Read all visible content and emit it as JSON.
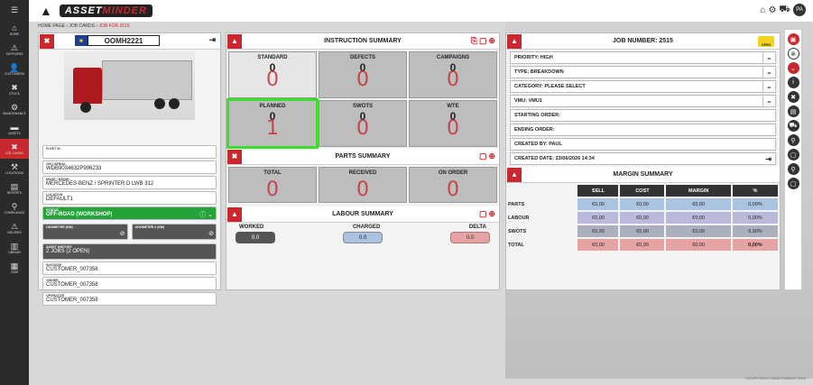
{
  "nav": [
    {
      "icon": "☰",
      "label": ""
    },
    {
      "icon": "⌂",
      "label": "Home"
    },
    {
      "icon": "⚠",
      "label": "Suppliers"
    },
    {
      "icon": "👤",
      "label": "Customers"
    },
    {
      "icon": "✖",
      "label": "Stock"
    },
    {
      "icon": "⚙",
      "label": "Maintenance"
    },
    {
      "icon": "▬",
      "label": "Assets"
    },
    {
      "icon": "✖",
      "label": "Job Cards"
    },
    {
      "icon": "⚒",
      "label": "Locations"
    },
    {
      "icon": "▤",
      "label": "Reports"
    },
    {
      "icon": "⚲",
      "label": "Compliance"
    },
    {
      "icon": "⚠",
      "label": "Drivers"
    },
    {
      "icon": "▥",
      "label": "Library"
    },
    {
      "icon": "▦",
      "label": "DSM"
    }
  ],
  "brand": {
    "prefix": "ASSET",
    "suffix": "MINDER"
  },
  "avatar": "PA",
  "breadcrumb": {
    "home": "HOME PAGE",
    "sep": " › ",
    "jobcards": "JOB CARDS",
    "current": "JOB FOR 2515"
  },
  "asset": {
    "reg": "OOMH2221",
    "fleet_id_label": "FLEET ID",
    "fleet_id": "",
    "vin_label": "VIN / SERIAL",
    "vin": "WDB9034632P996233",
    "make_label": "MAKE / MODEL",
    "make": "MERCEDES-BENZ / SPRINTER D LWB 312",
    "location_label": "LOCATION",
    "location": "DEFAULT1",
    "status_label": "STATUS",
    "status": "OFF-ROAD (WORKSHOP)",
    "odo_label": "ODOMETER (KM)",
    "odo2_label": "ODOMETER 2 (KM)",
    "history_label": "ASSET HISTORY",
    "history": "2 JOBS (2 OPEN)",
    "invoicee_label": "INVOICEE",
    "invoicee": "CUSTOMER_007358",
    "owner_label": "OWNER",
    "owner": "CUSTOMER_007358",
    "operator_label": "OPERATOR",
    "operator": "CUSTOMER_007358"
  },
  "instruction": {
    "title": "INSTRUCTION SUMMARY",
    "cells": [
      {
        "t": "STANDARD",
        "n": "0",
        "g": "0"
      },
      {
        "t": "DEFECTS",
        "n": "0",
        "g": "0"
      },
      {
        "t": "CAMPAIGNS",
        "n": "0",
        "g": "0"
      },
      {
        "t": "PLANNED",
        "n": "0",
        "g": "1"
      },
      {
        "t": "SWOTS",
        "n": "0",
        "g": "0"
      },
      {
        "t": "WTE",
        "n": "0",
        "g": "0"
      }
    ]
  },
  "parts": {
    "title": "PARTS SUMMARY",
    "cells": [
      {
        "t": "TOTAL",
        "g": "0"
      },
      {
        "t": "RECEIVED",
        "g": "0"
      },
      {
        "t": "ON ORDER",
        "g": "0"
      }
    ]
  },
  "labour": {
    "title": "LABOUR SUMMARY",
    "worked_label": "WORKED",
    "charged_label": "CHARGED",
    "delta_label": "DELTA",
    "worked": "0.0",
    "charged": "0.0",
    "delta": "0.0"
  },
  "job": {
    "title": "JOB NUMBER: 2515",
    "badge": "OPEN",
    "priority": "PRIORITY: HIGH",
    "type": "TYPE: BREAKDOWN",
    "category": "CATEGORY: PLEASE SELECT",
    "vmu": "VMU: VMU1",
    "starting": "STARTING ORDER:",
    "ending": "ENDING ORDER:",
    "created_by": "CREATED BY: PAUL",
    "created_date": "CREATED DATE: 23/06/2026 14:34"
  },
  "margin": {
    "title": "MARGIN SUMMARY",
    "headers": [
      "SELL",
      "COST",
      "MARGIN",
      "%"
    ],
    "rows": [
      {
        "label": "PARTS",
        "vals": [
          "€0,00",
          "€0,00",
          "€0,00",
          "0,00%"
        ]
      },
      {
        "label": "LABOUR",
        "vals": [
          "€0,00",
          "€0,00",
          "€0,00",
          "0,00%"
        ]
      },
      {
        "label": "SWOTS",
        "vals": [
          "€0,00",
          "€0,00",
          "€0,00",
          "0,00%"
        ]
      },
      {
        "label": "TOTAL",
        "vals": [
          "€0,00",
          "€0,00",
          "€0,00",
          "0,00%"
        ]
      }
    ]
  },
  "copyright": "©COPYRIGHT ASSETMINDER 2023"
}
